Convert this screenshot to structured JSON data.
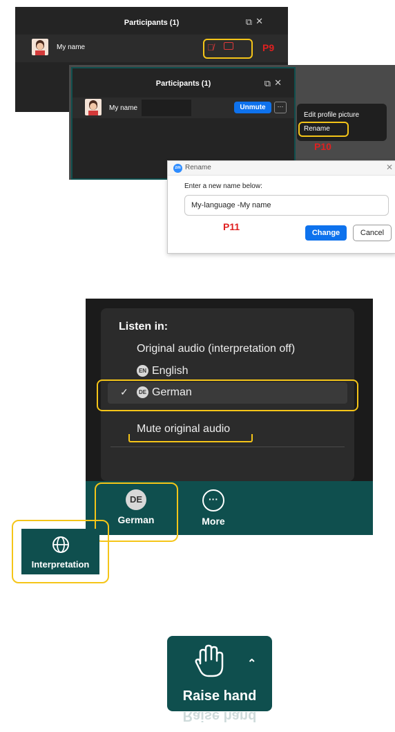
{
  "panel1": {
    "title": "Participants (1)",
    "participant_name": "My name",
    "tag": "P9"
  },
  "panel2": {
    "title": "Participants (1)",
    "participant_name": "My name",
    "unmute_label": "Unmute",
    "more_label": "···",
    "menu": {
      "edit": "Edit profile picture",
      "rename": "Rename"
    },
    "tag": "P10"
  },
  "rename_dialog": {
    "logo": "zm",
    "title": "Rename",
    "prompt": "Enter a new name below:",
    "value": "My-language -My name",
    "change": "Change",
    "cancel": "Cancel",
    "tag": "P11"
  },
  "listen_menu": {
    "header": "Listen in:",
    "original": "Original audio (interpretation off)",
    "en_badge": "EN",
    "english": "English",
    "check": "✓",
    "de_badge": "DE",
    "german": "German",
    "mute": "Mute original audio"
  },
  "toolbar": {
    "german_badge": "DE",
    "german_label": "German",
    "more_label": "More",
    "interpretation_label": "Interpretation"
  },
  "raise_hand": {
    "label": "Raise hand",
    "reflection": "Raise hand"
  },
  "icons": {
    "popout": "popout-icon",
    "close": "close-icon",
    "mic_muted": "mic-muted-icon",
    "video_off": "video-off-icon",
    "globe": "globe-icon",
    "ellipsis": "ellipsis-icon",
    "hand": "hand-icon",
    "chevron": "chevron-up-icon"
  },
  "colors": {
    "panel_bg": "#242424",
    "accent_blue": "#0e72ed",
    "highlight_yellow": "#f5c518",
    "label_red": "#e02020",
    "toolbar_teal": "#0f4f4e"
  }
}
